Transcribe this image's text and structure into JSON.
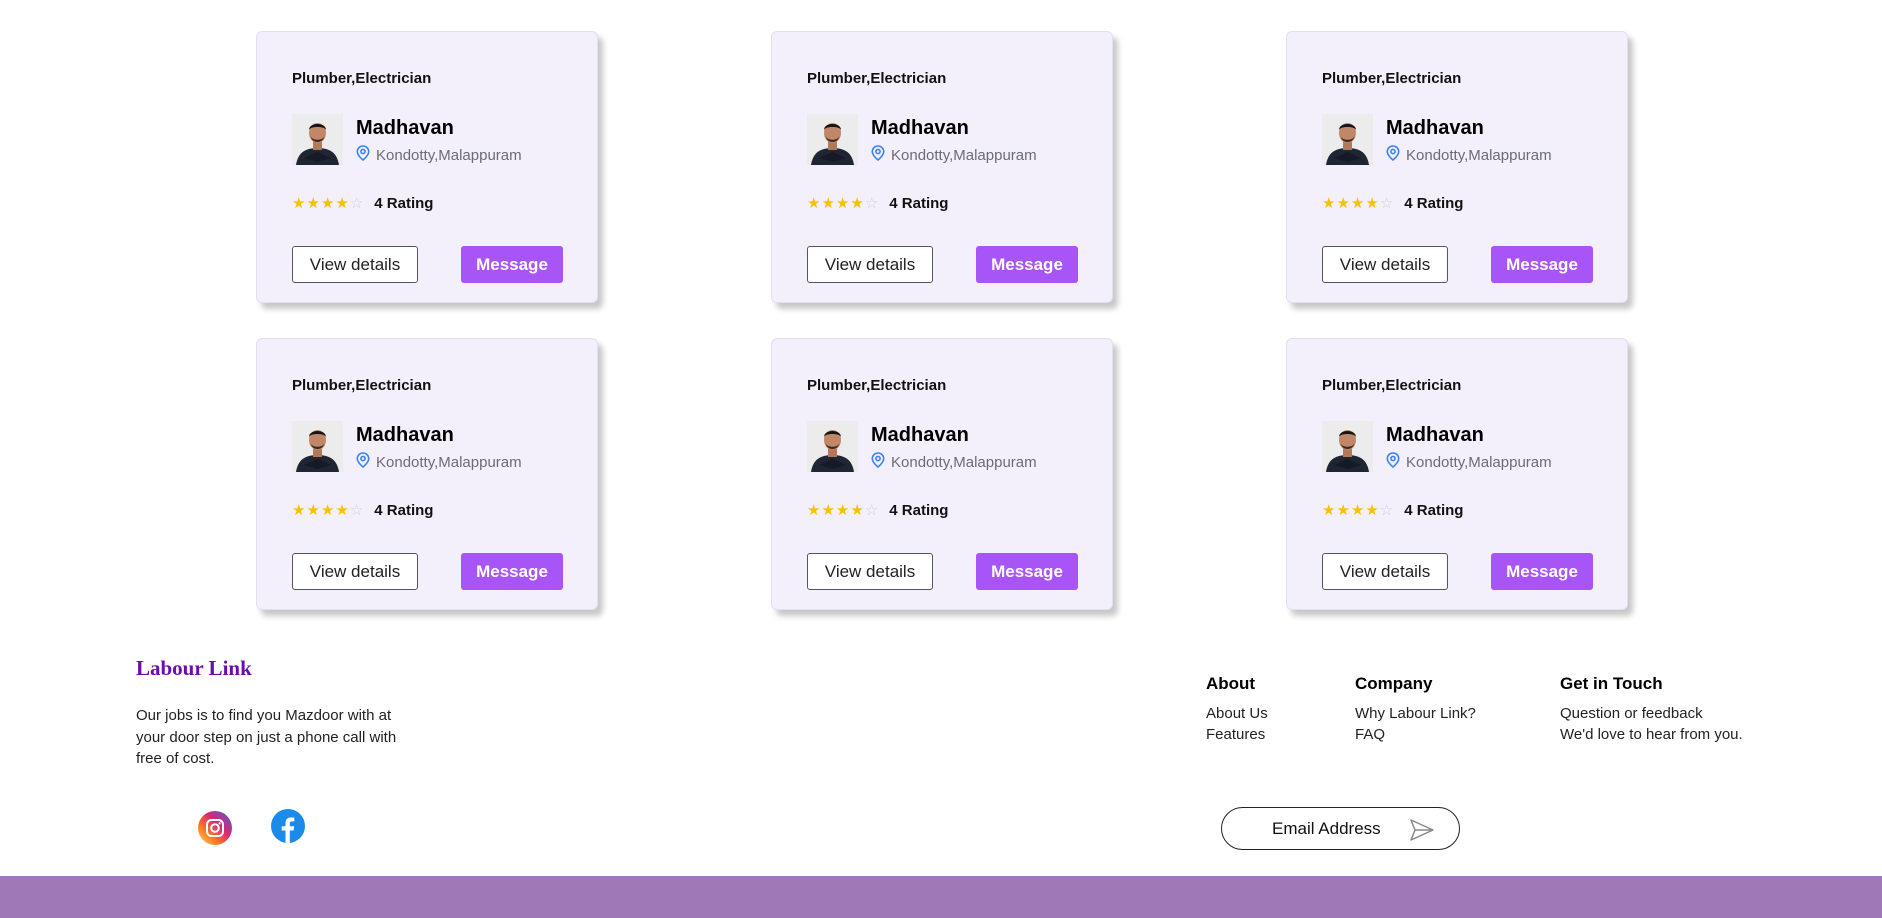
{
  "cards": [
    {
      "profession": "Plumber,Electrician",
      "name": "Madhavan",
      "location": "Kondotty,Malappuram",
      "rating": 4,
      "rating_text": "4 Rating",
      "view_label": "View details",
      "message_label": "Message"
    },
    {
      "profession": "Plumber,Electrician",
      "name": "Madhavan",
      "location": "Kondotty,Malappuram",
      "rating": 4,
      "rating_text": "4 Rating",
      "view_label": "View details",
      "message_label": "Message"
    },
    {
      "profession": "Plumber,Electrician",
      "name": "Madhavan",
      "location": "Kondotty,Malappuram",
      "rating": 4,
      "rating_text": "4 Rating",
      "view_label": "View details",
      "message_label": "Message"
    },
    {
      "profession": "Plumber,Electrician",
      "name": "Madhavan",
      "location": "Kondotty,Malappuram",
      "rating": 4,
      "rating_text": "4 Rating",
      "view_label": "View details",
      "message_label": "Message"
    },
    {
      "profession": "Plumber,Electrician",
      "name": "Madhavan",
      "location": "Kondotty,Malappuram",
      "rating": 4,
      "rating_text": "4 Rating",
      "view_label": "View details",
      "message_label": "Message"
    },
    {
      "profession": "Plumber,Electrician",
      "name": "Madhavan",
      "location": "Kondotty,Malappuram",
      "rating": 4,
      "rating_text": "4 Rating",
      "view_label": "View details",
      "message_label": "Message"
    }
  ],
  "rating_max": 5,
  "footer": {
    "brand": "Labour Link",
    "description": "Our jobs is to find you Mazdoor with at your door step on just a phone call with free of cost.",
    "social": [
      {
        "icon": "instagram-icon"
      },
      {
        "icon": "facebook-icon"
      }
    ],
    "about": {
      "heading": "About",
      "links": [
        "About Us",
        "Features"
      ]
    },
    "company": {
      "heading": "Company",
      "links": [
        "Why Labour Link?",
        "FAQ"
      ]
    },
    "contact": {
      "heading": "Get in Touch",
      "lines": [
        "Question or feedback",
        "We'd love to hear from you."
      ]
    },
    "email_placeholder": "Email Address",
    "send_icon": "send-icon"
  },
  "colors": {
    "accent": "#a855f7",
    "brand": "#6a0dad",
    "card_bg": "#f4f0fb",
    "bottom_bar": "#9e79b7",
    "star": "#f5c200",
    "location_pin": "#3b82f6"
  }
}
